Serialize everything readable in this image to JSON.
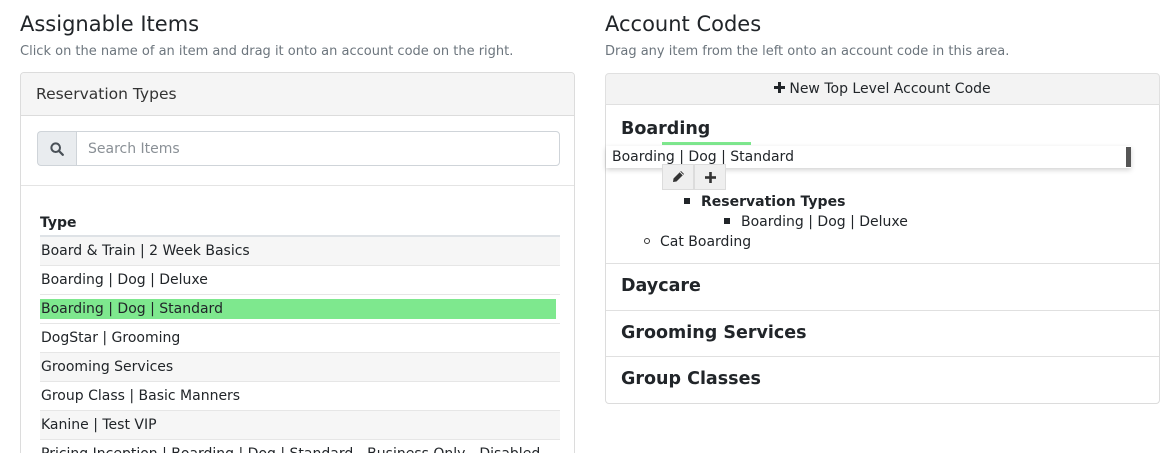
{
  "assignable": {
    "title": "Assignable Items",
    "subtitle": "Click on the name of an item and drag it onto an account code on the right.",
    "card_header": "Reservation Types",
    "search": {
      "placeholder": "Search Items",
      "value": "",
      "icon": "search-icon"
    },
    "table": {
      "column_header": "Type",
      "rows": [
        "Board & Train | 2 Week Basics",
        "Boarding | Dog | Deluxe",
        "Boarding | Dog | Standard",
        "DogStar | Grooming",
        "Grooming Services",
        "Group Class | Basic Manners",
        "Kanine | Test VIP",
        "Pricing Inception | Boarding | Dog | Standard - Business Only - Disabled"
      ],
      "selected_index": 2
    }
  },
  "account_codes": {
    "title": "Account Codes",
    "subtitle": "Drag any item from the left onto an account code in this area.",
    "new_button": {
      "label": "New Top Level Account Code",
      "icon": "plus-icon"
    },
    "dragging_item": "Boarding | Dog | Standard",
    "codes": [
      {
        "name": "Boarding",
        "actions": [
          "pencil-icon",
          "plus-icon"
        ],
        "assigned_group": "Reservation Types",
        "assigned_items": [
          "Boarding | Dog | Deluxe"
        ],
        "children": [
          "Cat Boarding"
        ]
      },
      {
        "name": "Daycare"
      },
      {
        "name": "Grooming Services"
      },
      {
        "name": "Group Classes"
      }
    ]
  },
  "colors": {
    "selected_highlight": "#7ee88e",
    "drop_indicator": "#7ee88e"
  }
}
